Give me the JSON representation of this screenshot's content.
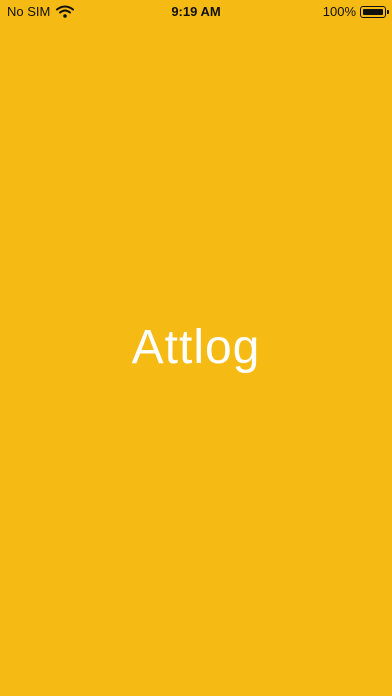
{
  "colors": {
    "background": "#F5BA14",
    "title_text": "#FFFFFF",
    "status_text": "#111111"
  },
  "status_bar": {
    "carrier": "No SIM",
    "wifi_icon": "wifi-icon",
    "time": "9:19 AM",
    "battery_percent": "100%",
    "battery_icon": "battery-icon",
    "battery_level": 1.0
  },
  "splash": {
    "title": "Attlog"
  }
}
